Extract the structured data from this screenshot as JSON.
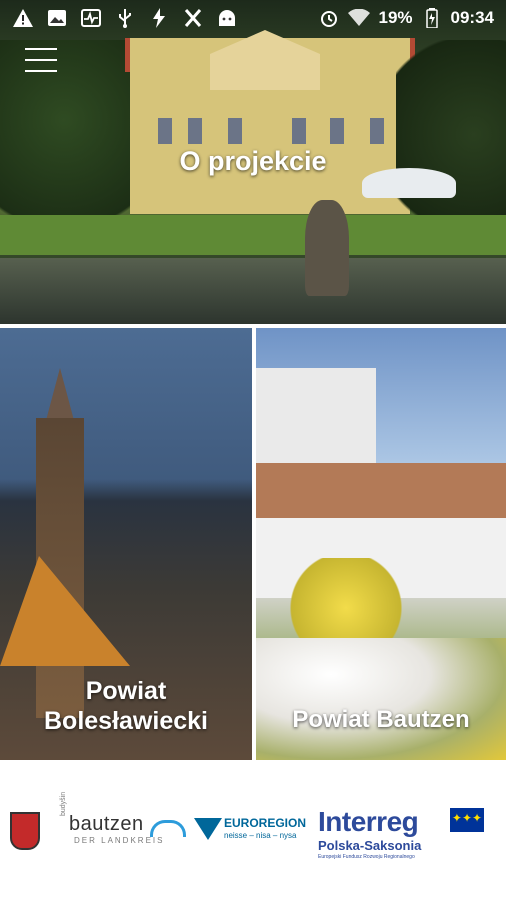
{
  "status_bar": {
    "battery": "19%",
    "time": "09:34"
  },
  "hero": {
    "title": "O projekcie"
  },
  "tiles": {
    "left_title_line1": "Powiat",
    "left_title_line2": "Bolesławiecki",
    "right_title": "Powiat Bautzen"
  },
  "logos": {
    "bautzen_vertical": "budyšin",
    "bautzen_main": "bautzen",
    "bautzen_sub": "DER LANDKREIS",
    "euroregion_title": "EUROREGION",
    "euroregion_sub": "neisse – nisa – nysa",
    "interreg_title": "Interreg",
    "interreg_sub": "Polska-Saksonia",
    "interreg_small": "Europejski Fundusz Rozwoju Regionalnego"
  },
  "icons": [
    "warning-icon",
    "image-icon",
    "activity-icon",
    "usb-icon",
    "flash-icon",
    "x-icon",
    "android-icon",
    "alarm-icon",
    "wifi-icon",
    "battery-icon",
    "menu-icon"
  ]
}
